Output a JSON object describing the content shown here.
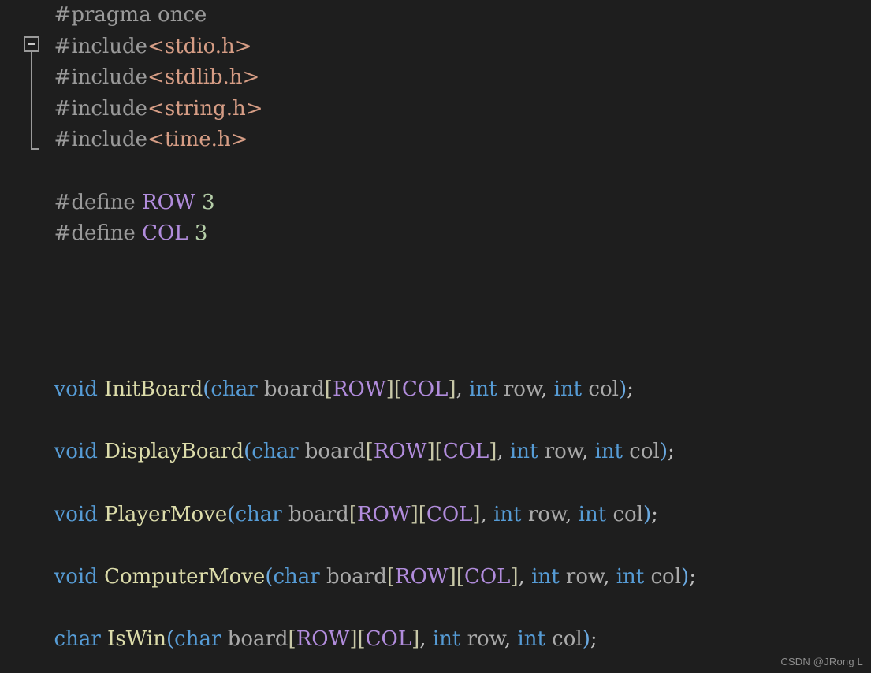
{
  "editor": {
    "background_color": "#1e1e1e",
    "language": "c-header",
    "font_size_px": 26
  },
  "gutter": {
    "fold_marker": "collapse-minus",
    "fold_region_start_line": 2,
    "fold_region_end_line": 5
  },
  "code": {
    "lines": [
      {
        "n": 1,
        "tokens": [
          {
            "t": "  ",
            "c": "plain"
          },
          {
            "t": "#pragma once",
            "c": "pre"
          }
        ]
      },
      {
        "n": 2,
        "tokens": [
          {
            "t": "  ",
            "c": "plain"
          },
          {
            "t": "#include",
            "c": "pre"
          },
          {
            "t": "<stdio.h>",
            "c": "string"
          }
        ]
      },
      {
        "n": 3,
        "tokens": [
          {
            "t": "  ",
            "c": "plain"
          },
          {
            "t": "#include",
            "c": "pre"
          },
          {
            "t": "<stdlib.h>",
            "c": "string"
          }
        ]
      },
      {
        "n": 4,
        "tokens": [
          {
            "t": "  ",
            "c": "plain"
          },
          {
            "t": "#include",
            "c": "pre"
          },
          {
            "t": "<string.h>",
            "c": "string"
          }
        ]
      },
      {
        "n": 5,
        "tokens": [
          {
            "t": "  ",
            "c": "plain"
          },
          {
            "t": "#include",
            "c": "pre"
          },
          {
            "t": "<time.h>",
            "c": "string"
          }
        ]
      },
      {
        "n": 6,
        "tokens": []
      },
      {
        "n": 7,
        "tokens": [
          {
            "t": "  ",
            "c": "plain"
          },
          {
            "t": "#define ",
            "c": "pre"
          },
          {
            "t": "ROW",
            "c": "macro"
          },
          {
            "t": " ",
            "c": "plain"
          },
          {
            "t": "3",
            "c": "num"
          }
        ]
      },
      {
        "n": 8,
        "tokens": [
          {
            "t": "  ",
            "c": "plain"
          },
          {
            "t": "#define ",
            "c": "pre"
          },
          {
            "t": "COL",
            "c": "macro"
          },
          {
            "t": " ",
            "c": "plain"
          },
          {
            "t": "3",
            "c": "num"
          }
        ]
      },
      {
        "n": 9,
        "tokens": []
      },
      {
        "n": 10,
        "tokens": []
      },
      {
        "n": 11,
        "tokens": []
      },
      {
        "n": 12,
        "tokens": []
      },
      {
        "n": 13,
        "tokens": [
          {
            "t": "  ",
            "c": "plain"
          },
          {
            "t": "void",
            "c": "kw"
          },
          {
            "t": " ",
            "c": "plain"
          },
          {
            "t": "InitBoard",
            "c": "fn"
          },
          {
            "t": "(",
            "c": "paren"
          },
          {
            "t": "char",
            "c": "kw"
          },
          {
            "t": " board",
            "c": "plain"
          },
          {
            "t": "[",
            "c": "bracket"
          },
          {
            "t": "ROW",
            "c": "macro"
          },
          {
            "t": "]",
            "c": "bracket"
          },
          {
            "t": "[",
            "c": "bracket"
          },
          {
            "t": "COL",
            "c": "macro"
          },
          {
            "t": "]",
            "c": "bracket"
          },
          {
            "t": ", ",
            "c": "punct"
          },
          {
            "t": "int",
            "c": "kw"
          },
          {
            "t": " row",
            "c": "plain"
          },
          {
            "t": ", ",
            "c": "punct"
          },
          {
            "t": "int",
            "c": "kw"
          },
          {
            "t": " col",
            "c": "plain"
          },
          {
            "t": ")",
            "c": "paren"
          },
          {
            "t": ";",
            "c": "punct"
          }
        ]
      },
      {
        "n": 14,
        "tokens": []
      },
      {
        "n": 15,
        "tokens": [
          {
            "t": "  ",
            "c": "plain"
          },
          {
            "t": "void",
            "c": "kw"
          },
          {
            "t": " ",
            "c": "plain"
          },
          {
            "t": "DisplayBoard",
            "c": "fn"
          },
          {
            "t": "(",
            "c": "paren"
          },
          {
            "t": "char",
            "c": "kw"
          },
          {
            "t": " board",
            "c": "plain"
          },
          {
            "t": "[",
            "c": "bracket"
          },
          {
            "t": "ROW",
            "c": "macro"
          },
          {
            "t": "]",
            "c": "bracket"
          },
          {
            "t": "[",
            "c": "bracket"
          },
          {
            "t": "COL",
            "c": "macro"
          },
          {
            "t": "]",
            "c": "bracket"
          },
          {
            "t": ", ",
            "c": "punct"
          },
          {
            "t": "int",
            "c": "kw"
          },
          {
            "t": " row",
            "c": "plain"
          },
          {
            "t": ", ",
            "c": "punct"
          },
          {
            "t": "int",
            "c": "kw"
          },
          {
            "t": " col",
            "c": "plain"
          },
          {
            "t": ")",
            "c": "paren"
          },
          {
            "t": ";",
            "c": "punct"
          }
        ]
      },
      {
        "n": 16,
        "tokens": []
      },
      {
        "n": 17,
        "tokens": [
          {
            "t": "  ",
            "c": "plain"
          },
          {
            "t": "void",
            "c": "kw"
          },
          {
            "t": " ",
            "c": "plain"
          },
          {
            "t": "PlayerMove",
            "c": "fn"
          },
          {
            "t": "(",
            "c": "paren"
          },
          {
            "t": "char",
            "c": "kw"
          },
          {
            "t": " board",
            "c": "plain"
          },
          {
            "t": "[",
            "c": "bracket"
          },
          {
            "t": "ROW",
            "c": "macro"
          },
          {
            "t": "]",
            "c": "bracket"
          },
          {
            "t": "[",
            "c": "bracket"
          },
          {
            "t": "COL",
            "c": "macro"
          },
          {
            "t": "]",
            "c": "bracket"
          },
          {
            "t": ", ",
            "c": "punct"
          },
          {
            "t": "int",
            "c": "kw"
          },
          {
            "t": " row",
            "c": "plain"
          },
          {
            "t": ", ",
            "c": "punct"
          },
          {
            "t": "int",
            "c": "kw"
          },
          {
            "t": " col",
            "c": "plain"
          },
          {
            "t": ")",
            "c": "paren"
          },
          {
            "t": ";",
            "c": "punct"
          }
        ]
      },
      {
        "n": 18,
        "tokens": []
      },
      {
        "n": 19,
        "tokens": [
          {
            "t": "  ",
            "c": "plain"
          },
          {
            "t": "void",
            "c": "kw"
          },
          {
            "t": " ",
            "c": "plain"
          },
          {
            "t": "ComputerMove",
            "c": "fn"
          },
          {
            "t": "(",
            "c": "paren"
          },
          {
            "t": "char",
            "c": "kw"
          },
          {
            "t": " board",
            "c": "plain"
          },
          {
            "t": "[",
            "c": "bracket"
          },
          {
            "t": "ROW",
            "c": "macro"
          },
          {
            "t": "]",
            "c": "bracket"
          },
          {
            "t": "[",
            "c": "bracket"
          },
          {
            "t": "COL",
            "c": "macro"
          },
          {
            "t": "]",
            "c": "bracket"
          },
          {
            "t": ", ",
            "c": "punct"
          },
          {
            "t": "int",
            "c": "kw"
          },
          {
            "t": " row",
            "c": "plain"
          },
          {
            "t": ", ",
            "c": "punct"
          },
          {
            "t": "int",
            "c": "kw"
          },
          {
            "t": " col",
            "c": "plain"
          },
          {
            "t": ")",
            "c": "paren"
          },
          {
            "t": ";",
            "c": "punct"
          }
        ]
      },
      {
        "n": 20,
        "tokens": []
      },
      {
        "n": 21,
        "tokens": [
          {
            "t": "  ",
            "c": "plain"
          },
          {
            "t": "char",
            "c": "kw"
          },
          {
            "t": " ",
            "c": "plain"
          },
          {
            "t": "IsWin",
            "c": "fn"
          },
          {
            "t": "(",
            "c": "paren"
          },
          {
            "t": "char",
            "c": "kw"
          },
          {
            "t": " board",
            "c": "plain"
          },
          {
            "t": "[",
            "c": "bracket"
          },
          {
            "t": "ROW",
            "c": "macro"
          },
          {
            "t": "]",
            "c": "bracket"
          },
          {
            "t": "[",
            "c": "bracket"
          },
          {
            "t": "COL",
            "c": "macro"
          },
          {
            "t": "]",
            "c": "bracket"
          },
          {
            "t": ", ",
            "c": "punct"
          },
          {
            "t": "int",
            "c": "kw"
          },
          {
            "t": " row",
            "c": "plain"
          },
          {
            "t": ", ",
            "c": "punct"
          },
          {
            "t": "int",
            "c": "kw"
          },
          {
            "t": " col",
            "c": "plain"
          },
          {
            "t": ")",
            "c": "paren"
          },
          {
            "t": ";",
            "c": "punct"
          }
        ]
      }
    ]
  },
  "watermark": {
    "text": "CSDN @JRong L"
  },
  "colors": {
    "background": "#1e1e1e",
    "plain": "#a9a9a9",
    "preprocessor": "#9a9a9a",
    "string": "#d69d85",
    "keyword": "#569cd6",
    "function": "#dcdcaa",
    "macro": "#b18cdc",
    "number": "#b5cea8",
    "punctuation": "#bcbcbc",
    "paren": "#6aa9e0",
    "bracket": "#c8c8a8",
    "fold_marker": "#9a9a9a",
    "watermark": "#8d8d8d"
  }
}
